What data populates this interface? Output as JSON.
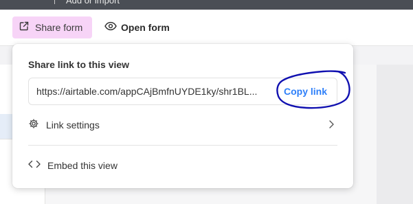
{
  "topbar": {
    "text": "Add or import"
  },
  "toolbar": {
    "share_form_label": "Share form",
    "open_form_label": "Open form"
  },
  "popover": {
    "title": "Share link to this view",
    "link_url": "https://airtable.com/appCAjBmfnUYDE1ky/shr1BL...",
    "copy_link_label": "Copy link",
    "link_settings_label": "Link settings",
    "embed_label": "Embed this view"
  },
  "colors": {
    "share_button_bg": "#f7d4f7",
    "copy_link": "#2d7ff9",
    "annotation_ink": "#1010b0"
  },
  "icons": {
    "share": "external-link-icon",
    "open": "eye-icon",
    "settings": "gear-icon",
    "chevron": "chevron-right-icon",
    "embed": "code-brackets-icon"
  }
}
